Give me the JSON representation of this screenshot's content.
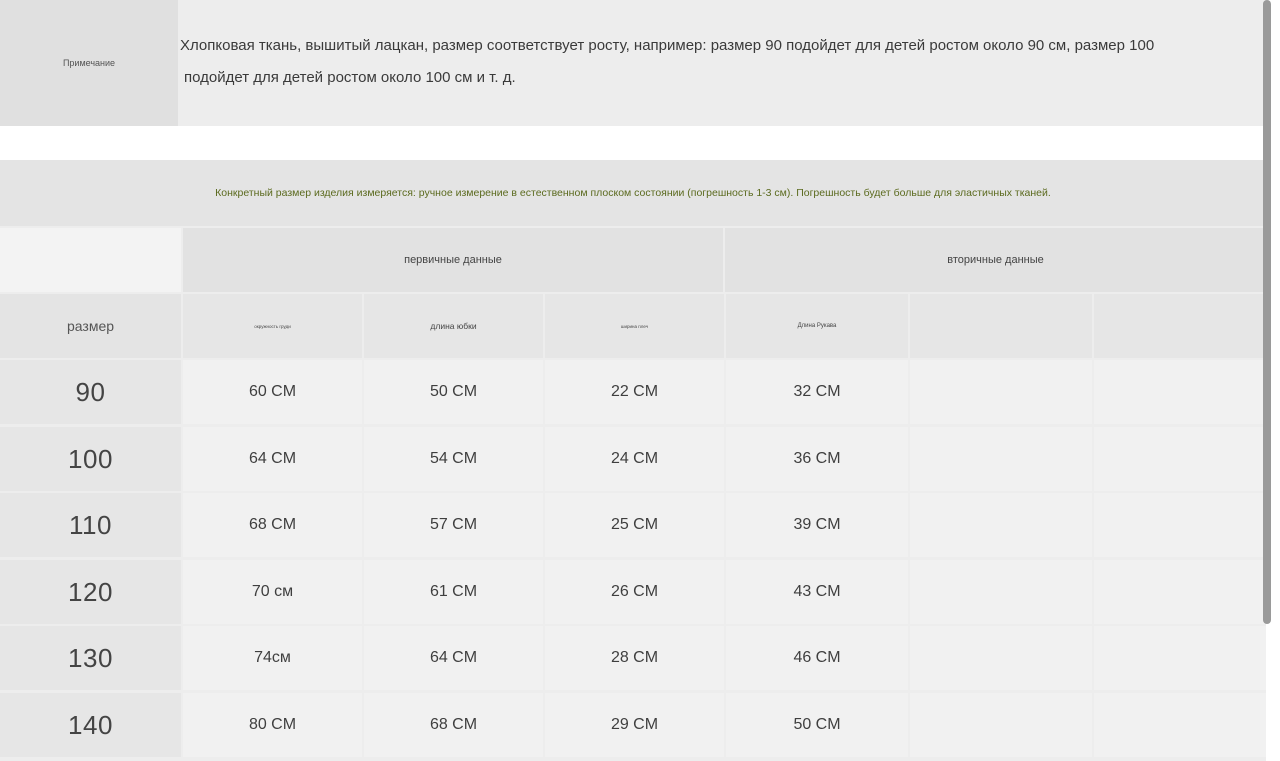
{
  "note": {
    "label": "Примечание",
    "text_line1": "Хлопковая ткань, вышитый лацкан, размер соответствует росту, например: размер 90 подойдет для детей ростом около 90 см, размер 100",
    "text_line2": "подойдет для детей ростом около 100 см и т. д."
  },
  "table": {
    "banner": "Конкретный размер изделия измеряется: ручное измерение в естественном плоском состоянии (погрешность 1-3 см). Погрешность будет больше для эластичных тканей.",
    "group_primary": "первичные данные",
    "group_secondary": "вторичные данные",
    "size_header": "размер",
    "sub_headers": [
      "окружность груди",
      "длина юбки",
      "ширина плеч",
      "Длина Рукава",
      "",
      ""
    ],
    "rows": [
      {
        "size": "90",
        "values": [
          "60 CM",
          "50 CM",
          "22 CM",
          "32 CM"
        ]
      },
      {
        "size": "100",
        "values": [
          "64 CM",
          "54 CM",
          "24 CM",
          "36 CM"
        ]
      },
      {
        "size": "110",
        "values": [
          "68 CM",
          "57 CM",
          "25 CM",
          "39 CM"
        ]
      },
      {
        "size": "120",
        "values": [
          "70 см",
          "61 CM",
          "26 CM",
          "43 CM"
        ]
      },
      {
        "size": "130",
        "values": [
          "74см",
          "64 CM",
          "28 CM",
          "46 CM"
        ]
      },
      {
        "size": "140",
        "values": [
          "80 CM",
          "68 CM",
          "29 CM",
          "50 CM"
        ]
      }
    ]
  },
  "colors": {
    "banner_text": "#5b6a1e",
    "scrollbar": "#9a9a9a"
  }
}
